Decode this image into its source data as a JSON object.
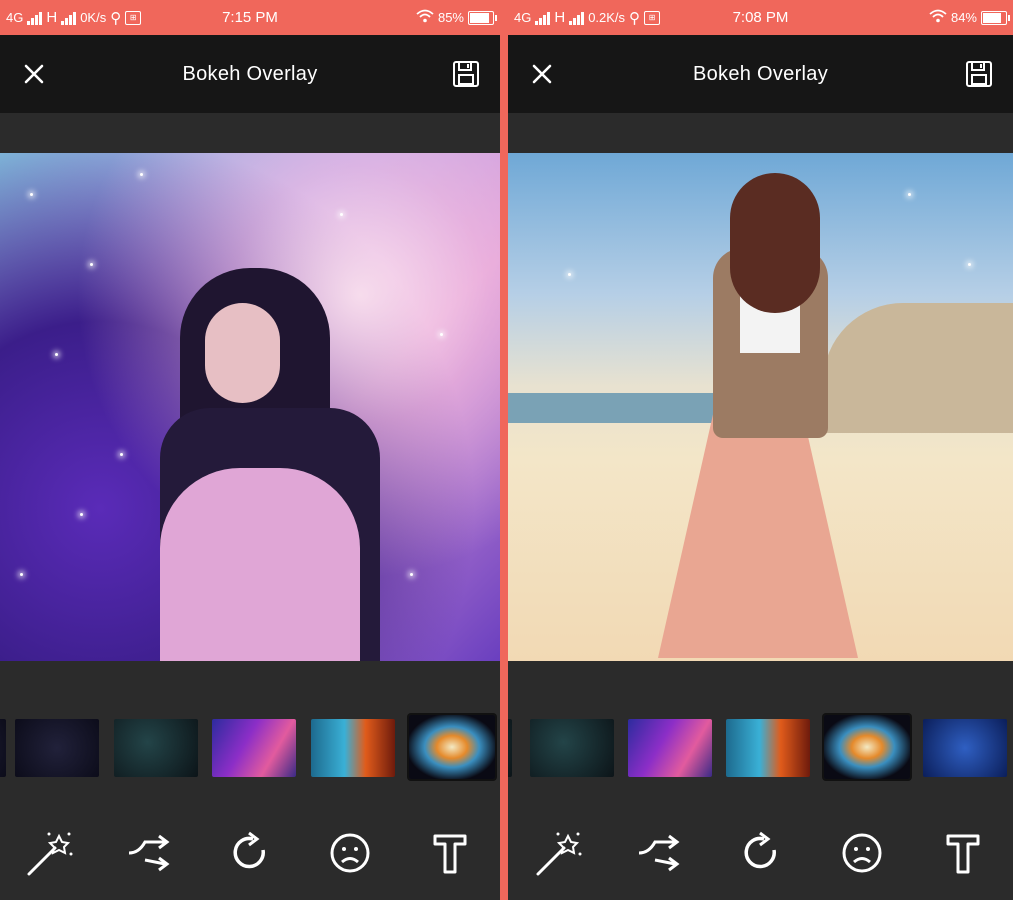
{
  "screens": [
    {
      "status": {
        "network": "4G",
        "network2": "H",
        "speed": "0K/s",
        "time": "7:15 PM",
        "battery": "85%",
        "battery_level": 0.85
      },
      "app_bar": {
        "title": "Bokeh Overlay",
        "close_icon": "close-icon",
        "save_icon": "save-icon"
      },
      "photo_scene": "galaxy-portrait",
      "filters": [
        "dark-starfield",
        "dark-teal-nebula",
        "purple-galaxy",
        "teal-orange-nebula",
        "orange-blue-nebula"
      ],
      "selected_filter": 4,
      "tools": [
        "magic-wand-icon",
        "shuffle-icon",
        "rotate-icon",
        "sad-face-icon",
        "text-icon"
      ]
    },
    {
      "status": {
        "network": "4G",
        "network2": "H",
        "speed": "0.2K/s",
        "time": "7:08 PM",
        "battery": "84%",
        "battery_level": 0.84
      },
      "app_bar": {
        "title": "Bokeh Overlay",
        "close_icon": "close-icon",
        "save_icon": "save-icon"
      },
      "photo_scene": "beach-portrait",
      "filters": [
        "dark-teal-nebula",
        "purple-galaxy",
        "teal-orange-nebula",
        "orange-blue-nebula",
        "blue-starfield"
      ],
      "selected_filter": 3,
      "tools": [
        "magic-wand-icon",
        "shuffle-icon",
        "rotate-icon",
        "sad-face-icon",
        "text-icon"
      ]
    }
  ]
}
